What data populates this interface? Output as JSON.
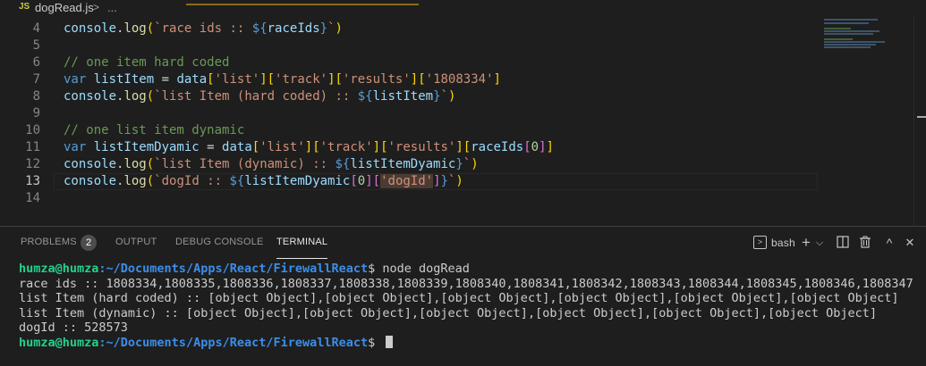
{
  "breadcrumb": {
    "file_icon": "JS",
    "file": "dogRead.js",
    "separator": ">",
    "ellipsis": "..."
  },
  "editor": {
    "lines": [
      {
        "n": "4",
        "tokens": [
          [
            "t-id",
            "console"
          ],
          [
            "t-pun",
            "."
          ],
          [
            "t-fn",
            "log"
          ],
          [
            "t-br1",
            "("
          ],
          [
            "t-str",
            "`race ids :: "
          ],
          [
            "t-var",
            "${"
          ],
          [
            "t-id",
            "raceIds"
          ],
          [
            "t-var",
            "}"
          ],
          [
            "t-str",
            "`"
          ],
          [
            "t-br1",
            ")"
          ]
        ]
      },
      {
        "n": "5",
        "tokens": []
      },
      {
        "n": "6",
        "tokens": [
          [
            "t-com",
            "// one item hard coded"
          ]
        ]
      },
      {
        "n": "7",
        "tokens": [
          [
            "t-var",
            "var "
          ],
          [
            "t-id",
            "listItem"
          ],
          [
            "t-pun",
            " = "
          ],
          [
            "t-id",
            "data"
          ],
          [
            "t-br1",
            "["
          ],
          [
            "t-str",
            "'list'"
          ],
          [
            "t-br1",
            "]["
          ],
          [
            "t-str",
            "'track'"
          ],
          [
            "t-br1",
            "]["
          ],
          [
            "t-str",
            "'results'"
          ],
          [
            "t-br1",
            "]["
          ],
          [
            "t-str",
            "'1808334'"
          ],
          [
            "t-br1",
            "]"
          ]
        ]
      },
      {
        "n": "8",
        "tokens": [
          [
            "t-id",
            "console"
          ],
          [
            "t-pun",
            "."
          ],
          [
            "t-fn",
            "log"
          ],
          [
            "t-br1",
            "("
          ],
          [
            "t-str",
            "`list Item (hard coded) :: "
          ],
          [
            "t-var",
            "${"
          ],
          [
            "t-id",
            "listItem"
          ],
          [
            "t-var",
            "}"
          ],
          [
            "t-str",
            "`"
          ],
          [
            "t-br1",
            ")"
          ]
        ]
      },
      {
        "n": "9",
        "tokens": []
      },
      {
        "n": "10",
        "tokens": [
          [
            "t-com",
            "// one list item dynamic"
          ]
        ]
      },
      {
        "n": "11",
        "tokens": [
          [
            "t-var",
            "var "
          ],
          [
            "t-id",
            "listItemDyamic"
          ],
          [
            "t-pun",
            " = "
          ],
          [
            "t-id",
            "data"
          ],
          [
            "t-br1",
            "["
          ],
          [
            "t-str",
            "'list'"
          ],
          [
            "t-br1",
            "]["
          ],
          [
            "t-str",
            "'track'"
          ],
          [
            "t-br1",
            "]["
          ],
          [
            "t-str",
            "'results'"
          ],
          [
            "t-br1",
            "]["
          ],
          [
            "t-id",
            "raceIds"
          ],
          [
            "t-br2",
            "["
          ],
          [
            "t-num",
            "0"
          ],
          [
            "t-br2",
            "]"
          ],
          [
            "t-br1",
            "]"
          ]
        ]
      },
      {
        "n": "12",
        "tokens": [
          [
            "t-id",
            "console"
          ],
          [
            "t-pun",
            "."
          ],
          [
            "t-fn",
            "log"
          ],
          [
            "t-br1",
            "("
          ],
          [
            "t-str",
            "`list Item (dynamic) :: "
          ],
          [
            "t-var",
            "${"
          ],
          [
            "t-id",
            "listItemDyamic"
          ],
          [
            "t-var",
            "}"
          ],
          [
            "t-str",
            "`"
          ],
          [
            "t-br1",
            ")"
          ]
        ]
      },
      {
        "n": "13",
        "tokens": [
          [
            "t-id",
            "console"
          ],
          [
            "t-pun",
            "."
          ],
          [
            "t-fn",
            "log"
          ],
          [
            "t-br1",
            "("
          ],
          [
            "t-str",
            "`dogId :: "
          ],
          [
            "t-var",
            "${"
          ],
          [
            "t-id",
            "listItemDyamic"
          ],
          [
            "t-br2",
            "["
          ],
          [
            "t-num",
            "0"
          ],
          [
            "t-br2",
            "]["
          ],
          [
            "t-str hl",
            "'dogId'"
          ],
          [
            "t-br2",
            "]"
          ],
          [
            "t-var",
            "}"
          ],
          [
            "t-str",
            "`"
          ],
          [
            "t-br1",
            ")"
          ]
        ]
      },
      {
        "n": "14",
        "tokens": []
      }
    ],
    "current_line": "13"
  },
  "panel": {
    "tabs": [
      {
        "label": "PROBLEMS",
        "active": false
      },
      {
        "label": "OUTPUT",
        "active": false
      },
      {
        "label": "DEBUG CONSOLE",
        "active": false
      },
      {
        "label": "TERMINAL",
        "active": true
      }
    ],
    "problems_count": "2",
    "shell_label": "bash",
    "icons": {
      "add": "+",
      "dropdown": "⌵",
      "maximize": "^",
      "close": "✕"
    }
  },
  "terminal": {
    "user": "humza@humza",
    "path": ":~/Documents/Apps/React/FirewallReact",
    "prompt_suffix": "$ ",
    "command": "node dogRead",
    "output": [
      "race ids :: 1808334,1808335,1808336,1808337,1808338,1808339,1808340,1808341,1808342,1808343,1808344,1808345,1808346,1808347",
      "list Item (hard coded) :: [object Object],[object Object],[object Object],[object Object],[object Object],[object Object]",
      "list Item (dynamic) :: [object Object],[object Object],[object Object],[object Object],[object Object],[object Object]",
      "dogId :: 528573"
    ]
  },
  "colors": {
    "background": "#1e1e1e",
    "prompt_user": "#23d18b",
    "prompt_path": "#3b8eea",
    "active_tab": "#e7e7e7"
  }
}
